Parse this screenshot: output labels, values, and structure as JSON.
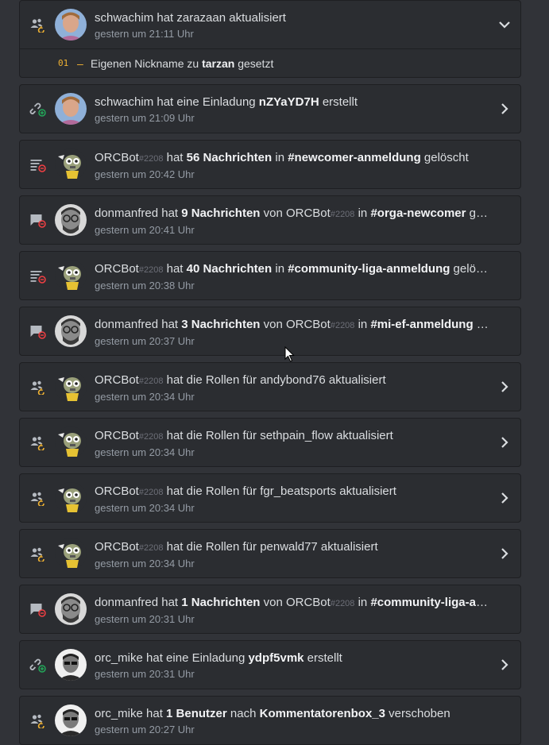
{
  "entries": [
    {
      "type": "member-update",
      "avatar": "schwachim",
      "user": "schwachim",
      "disc": "",
      "parts": [
        " hat zarazaan aktualisiert"
      ],
      "time": "gestern um 21:11 Uhr",
      "chevron": "down",
      "expanded": true,
      "detail": {
        "num": "01",
        "dash": "–",
        "pre": "Eigenen Nickname zu ",
        "bold": "tarzan",
        "post": " gesetzt"
      }
    },
    {
      "type": "invite-create",
      "avatar": "schwachim",
      "user": "schwachim",
      "disc": "",
      "parts": [
        " hat eine Einladung ",
        "*nZYaYD7H",
        " erstellt"
      ],
      "time": "gestern um 21:09 Uhr",
      "chevron": "right"
    },
    {
      "type": "bulk-delete",
      "avatar": "orcbot",
      "user": "ORCBot",
      "disc": "#2208",
      "parts": [
        " hat ",
        "*56 Nachrichten",
        " in ",
        "*#newcomer-anmeldung",
        " gelöscht"
      ],
      "time": "gestern um 20:42 Uhr",
      "chevron": ""
    },
    {
      "type": "message-delete",
      "avatar": "donmanfred",
      "user": "donmanfred",
      "disc": "",
      "parts": [
        " hat ",
        "*9 Nachrichten",
        " von ORCBot",
        "#2208",
        " in ",
        "*#orga-newcomer",
        " gel…"
      ],
      "time": "gestern um 20:41 Uhr",
      "chevron": ""
    },
    {
      "type": "bulk-delete",
      "avatar": "orcbot",
      "user": "ORCBot",
      "disc": "#2208",
      "parts": [
        " hat ",
        "*40 Nachrichten",
        " in ",
        "*#community-liga-anmeldung",
        " gelöscht"
      ],
      "time": "gestern um 20:38 Uhr",
      "chevron": ""
    },
    {
      "type": "message-delete",
      "avatar": "donmanfred",
      "user": "donmanfred",
      "disc": "",
      "parts": [
        " hat ",
        "*3 Nachrichten",
        " von ORCBot",
        "#2208",
        " in ",
        "*#mi-ef-anmeldung",
        " g…"
      ],
      "time": "gestern um 20:37 Uhr",
      "chevron": ""
    },
    {
      "type": "member-update",
      "avatar": "orcbot",
      "user": "ORCBot",
      "disc": "#2208",
      "parts": [
        " hat die Rollen für andybond76 aktualisiert"
      ],
      "time": "gestern um 20:34 Uhr",
      "chevron": "right"
    },
    {
      "type": "member-update",
      "avatar": "orcbot",
      "user": "ORCBot",
      "disc": "#2208",
      "parts": [
        " hat die Rollen für sethpain_flow aktualisiert"
      ],
      "time": "gestern um 20:34 Uhr",
      "chevron": "right"
    },
    {
      "type": "member-update",
      "avatar": "orcbot",
      "user": "ORCBot",
      "disc": "#2208",
      "parts": [
        " hat die Rollen für fgr_beatsports aktualisiert"
      ],
      "time": "gestern um 20:34 Uhr",
      "chevron": "right"
    },
    {
      "type": "member-update",
      "avatar": "orcbot",
      "user": "ORCBot",
      "disc": "#2208",
      "parts": [
        " hat die Rollen für penwald77 aktualisiert"
      ],
      "time": "gestern um 20:34 Uhr",
      "chevron": "right"
    },
    {
      "type": "message-delete",
      "avatar": "donmanfred",
      "user": "donmanfred",
      "disc": "",
      "parts": [
        " hat ",
        "*1 Nachrichten",
        " von ORCBot",
        "#2208",
        " in ",
        "*#community-liga-an…"
      ],
      "time": "gestern um 20:31 Uhr",
      "chevron": ""
    },
    {
      "type": "invite-create",
      "avatar": "orc_mike",
      "user": "orc_mike",
      "disc": "",
      "parts": [
        " hat eine Einladung ",
        "*ydpf5vmk",
        " erstellt"
      ],
      "time": "gestern um 20:31 Uhr",
      "chevron": "right"
    },
    {
      "type": "member-move",
      "avatar": "orc_mike",
      "user": "orc_mike",
      "disc": "",
      "parts": [
        " hat ",
        "*1 Benutzer",
        " nach ",
        "*Kommentatorenbox_3",
        " verschoben"
      ],
      "time": "gestern um 20:27 Uhr",
      "chevron": ""
    }
  ],
  "colors": {
    "accent_yellow": "#f0b232",
    "delete_red": "#f23f43",
    "create_green": "#23a559",
    "icon_gray": "#b5bac1"
  }
}
